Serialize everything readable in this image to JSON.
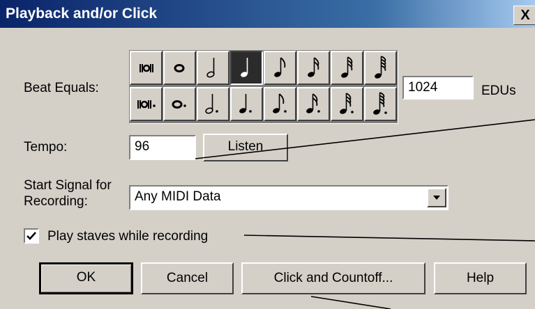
{
  "window": {
    "title": "Playback and/or Click",
    "close_label": "X"
  },
  "beat_equals": {
    "label": "Beat Equals:",
    "selected": "quarter",
    "top_row": [
      "double-whole",
      "whole",
      "half",
      "quarter",
      "eighth",
      "sixteenth",
      "thirty-second",
      "sixty-fourth"
    ],
    "bottom_row": [
      "dotted-double-whole",
      "dotted-whole",
      "dotted-half",
      "dotted-quarter",
      "dotted-eighth",
      "dotted-sixteenth",
      "dotted-thirty-second",
      "dotted-sixty-fourth"
    ],
    "edu_value": "1024",
    "edu_unit": "EDUs"
  },
  "tempo": {
    "label": "Tempo:",
    "value": "96",
    "listen_label": "Listen"
  },
  "start_signal": {
    "label_line1": "Start Signal for",
    "label_line2": "Recording:",
    "value": "Any MIDI Data"
  },
  "play_staves": {
    "label": "Play staves while recording",
    "checked": true
  },
  "buttons": {
    "ok": "OK",
    "cancel": "Cancel",
    "click_countoff": "Click and Countoff...",
    "help": "Help"
  }
}
